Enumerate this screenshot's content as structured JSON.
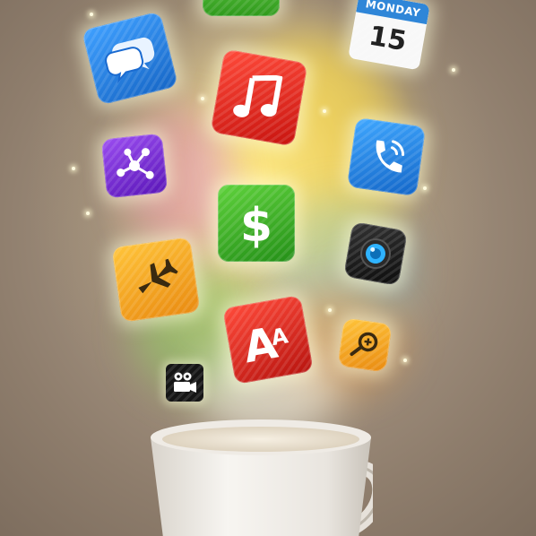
{
  "calendar": {
    "month": "MONDAY",
    "day": "15"
  },
  "icons": [
    "chat-bubbles-icon",
    "music-note-icon",
    "calendar-icon",
    "network-share-icon",
    "phone-icon",
    "dollar-icon",
    "camera-lens-icon",
    "airplane-icon",
    "font-size-icon",
    "zoom-in-icon",
    "video-camera-icon"
  ],
  "colors": {
    "chat": "#1f7fe0",
    "music": "#e0201f",
    "share": "#7a2fd6",
    "phone": "#1f86e8",
    "dollar": "#3fae2a",
    "camera": "#1c1c1c",
    "airplane": "#f3a21a",
    "font": "#d8261e",
    "zoom": "#f2a51a",
    "video": "#1a1a1a",
    "cup": "#f4f1ec"
  }
}
